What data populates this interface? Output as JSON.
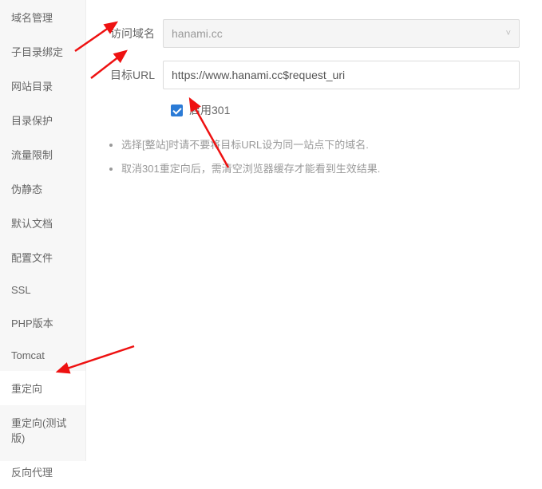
{
  "sidebar": {
    "items": [
      {
        "label": "域名管理"
      },
      {
        "label": "子目录绑定"
      },
      {
        "label": "网站目录"
      },
      {
        "label": "目录保护"
      },
      {
        "label": "流量限制"
      },
      {
        "label": "伪静态"
      },
      {
        "label": "默认文档"
      },
      {
        "label": "配置文件"
      },
      {
        "label": "SSL"
      },
      {
        "label": "PHP版本"
      },
      {
        "label": "Tomcat"
      },
      {
        "label": "重定向"
      },
      {
        "label": "重定向(测试版)"
      },
      {
        "label": "反向代理"
      }
    ],
    "active_index": 11
  },
  "form": {
    "domain_label": "访问域名",
    "domain_value": "hanami.cc",
    "target_label": "目标URL",
    "target_value": "https://www.hanami.cc$request_uri",
    "enable301_label": "启用301",
    "enable301_checked": true
  },
  "notes": [
    "选择[整站]时请不要将目标URL设为同一站点下的域名.",
    "取消301重定向后，需清空浏览器缓存才能看到生效结果."
  ]
}
